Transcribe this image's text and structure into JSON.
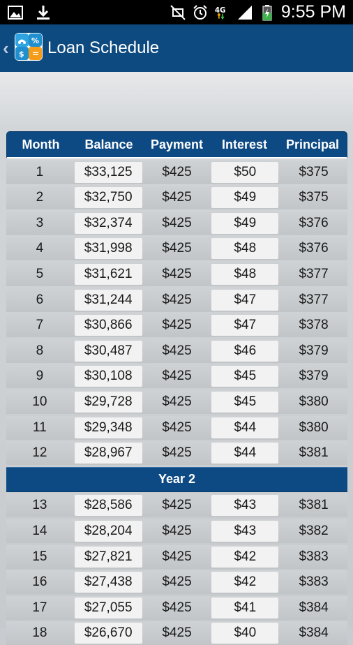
{
  "status_bar": {
    "time": "9:55 PM",
    "icons": [
      "image-icon",
      "download-icon",
      "mute-icon",
      "alarm-icon",
      "4g-lte-icon",
      "signal-icon",
      "battery-charging-icon"
    ]
  },
  "action_bar": {
    "title": "Loan Schedule",
    "icon_symbols": {
      "percent": "%",
      "dollar": "$",
      "equals": "="
    }
  },
  "table": {
    "headers": [
      "Month",
      "Balance",
      "Payment",
      "Interest",
      "Principal"
    ],
    "rows_year1": [
      [
        "1",
        "$33,125",
        "$425",
        "$50",
        "$375"
      ],
      [
        "2",
        "$32,750",
        "$425",
        "$49",
        "$375"
      ],
      [
        "3",
        "$32,374",
        "$425",
        "$49",
        "$376"
      ],
      [
        "4",
        "$31,998",
        "$425",
        "$48",
        "$376"
      ],
      [
        "5",
        "$31,621",
        "$425",
        "$48",
        "$377"
      ],
      [
        "6",
        "$31,244",
        "$425",
        "$47",
        "$377"
      ],
      [
        "7",
        "$30,866",
        "$425",
        "$47",
        "$378"
      ],
      [
        "8",
        "$30,487",
        "$425",
        "$46",
        "$379"
      ],
      [
        "9",
        "$30,108",
        "$425",
        "$45",
        "$379"
      ],
      [
        "10",
        "$29,728",
        "$425",
        "$45",
        "$380"
      ],
      [
        "11",
        "$29,348",
        "$425",
        "$44",
        "$380"
      ],
      [
        "12",
        "$28,967",
        "$425",
        "$44",
        "$381"
      ]
    ],
    "year_label": "Year 2",
    "rows_year2": [
      [
        "13",
        "$28,586",
        "$425",
        "$43",
        "$381"
      ],
      [
        "14",
        "$28,204",
        "$425",
        "$43",
        "$382"
      ],
      [
        "15",
        "$27,821",
        "$425",
        "$42",
        "$383"
      ],
      [
        "16",
        "$27,438",
        "$425",
        "$42",
        "$383"
      ],
      [
        "17",
        "$27,055",
        "$425",
        "$41",
        "$384"
      ],
      [
        "18",
        "$26,670",
        "$425",
        "$40",
        "$384"
      ]
    ]
  }
}
